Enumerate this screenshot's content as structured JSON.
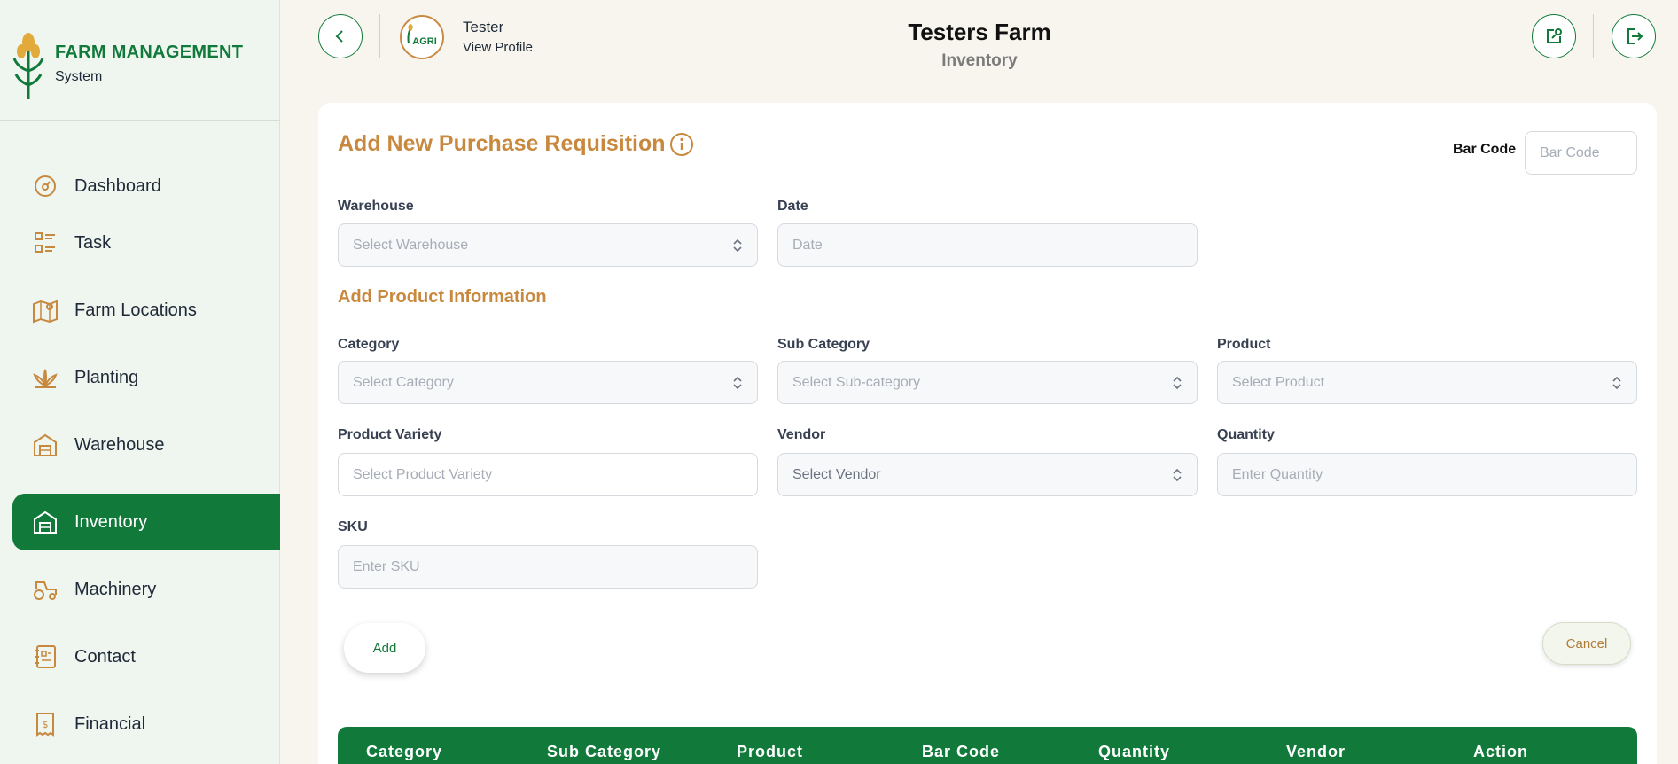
{
  "brand": {
    "title": "FARM MANAGEMENT",
    "subtitle": "System"
  },
  "sidebar": {
    "items": [
      {
        "label": "Dashboard",
        "icon": "dashboard-icon",
        "active": false
      },
      {
        "label": "Task",
        "icon": "task-list-icon",
        "active": false
      },
      {
        "label": "Farm Locations",
        "icon": "map-pin-icon",
        "active": false
      },
      {
        "label": "Planting",
        "icon": "plant-icon",
        "active": false
      },
      {
        "label": "Warehouse",
        "icon": "warehouse-icon",
        "active": false
      },
      {
        "label": "Inventory",
        "icon": "inventory-icon",
        "active": true
      },
      {
        "label": "Machinery",
        "icon": "tractor-icon",
        "active": false
      },
      {
        "label": "Contact",
        "icon": "contact-icon",
        "active": false
      },
      {
        "label": "Financial",
        "icon": "financial-icon",
        "active": false
      }
    ]
  },
  "header": {
    "user_name": "Tester",
    "profile_link": "View Profile",
    "avatar_text": "AGRI",
    "farm_title": "Testers Farm",
    "page_subtitle": "Inventory"
  },
  "form": {
    "title": "Add New Purchase Requisition",
    "barcode": {
      "label": "Bar Code",
      "placeholder": "Bar Code"
    },
    "warehouse": {
      "label": "Warehouse",
      "placeholder": "Select Warehouse"
    },
    "date": {
      "label": "Date",
      "placeholder": "Date"
    },
    "section_title": "Add Product Information",
    "category": {
      "label": "Category",
      "placeholder": "Select Category"
    },
    "sub_category": {
      "label": "Sub Category",
      "placeholder": "Select Sub-category"
    },
    "product": {
      "label": "Product",
      "placeholder": "Select Product"
    },
    "product_variety": {
      "label": "Product Variety",
      "placeholder": "Select Product Variety"
    },
    "vendor": {
      "label": "Vendor",
      "placeholder": "Select Vendor"
    },
    "quantity": {
      "label": "Quantity",
      "placeholder": "Enter Quantity"
    },
    "sku": {
      "label": "SKU",
      "placeholder": "Enter SKU"
    },
    "add_label": "Add",
    "cancel_label": "Cancel"
  },
  "table": {
    "columns": [
      "Category",
      "Sub Category",
      "Product",
      "Bar Code",
      "Quantity",
      "Vendor",
      "Action"
    ]
  },
  "colors": {
    "primary": "#117a3a",
    "accent": "#c8893f",
    "background": "#f7f5ee"
  }
}
